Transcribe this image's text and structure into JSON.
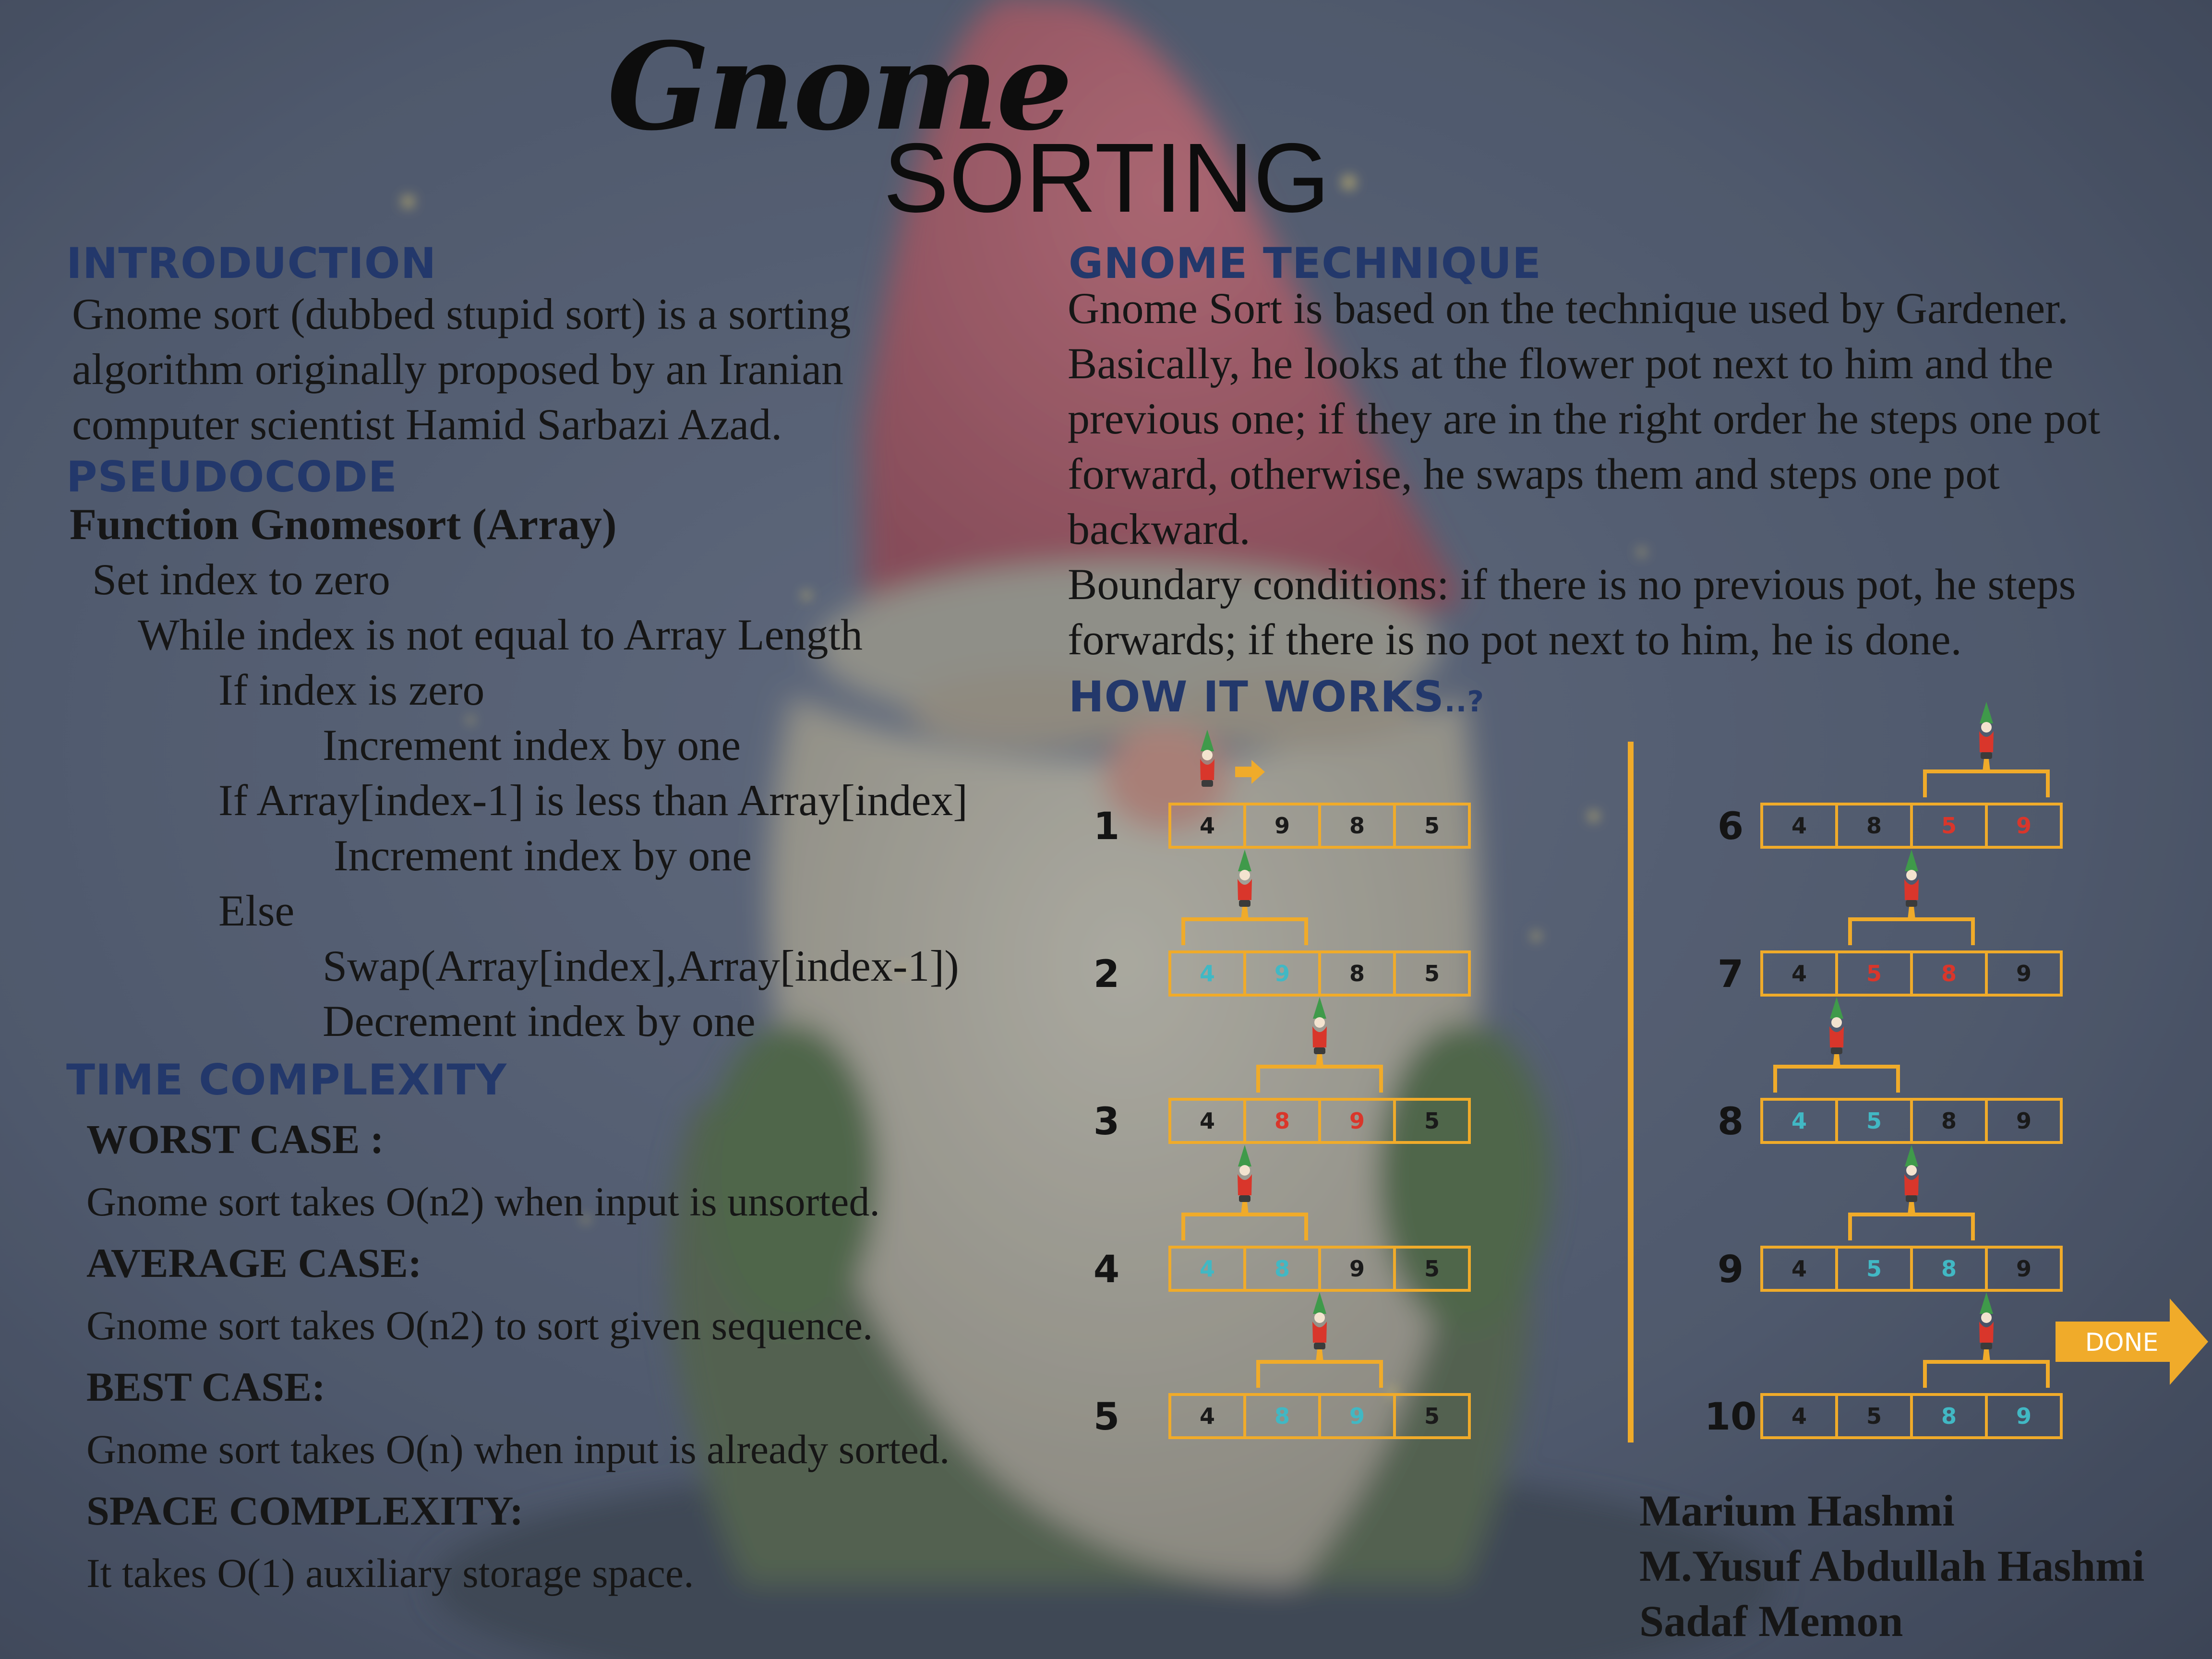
{
  "title": {
    "line1": "Gnome",
    "line2": "SORTING"
  },
  "introduction": {
    "heading": "INTRODUCTION",
    "lines": [
      "Gnome sort (dubbed stupid sort) is a sorting",
      "algorithm originally proposed by an Iranian",
      "computer scientist Hamid Sarbazi Azad."
    ]
  },
  "pseudocode": {
    "heading": "PSEUDOCODE",
    "lines": [
      "Function Gnomesort (Array)",
      "Set index to zero",
      "While index is not equal to Array Length",
      "If  index is zero",
      "Increment index by one",
      "If  Array[index-1] is less than Array[index]",
      "Increment index by one",
      "Else",
      "Swap(Array[index],Array[index-1])",
      "Decrement index by one"
    ]
  },
  "time_complexity": {
    "heading": "TIME COMPLEXITY",
    "worst_label": "WORST CASE :",
    "worst_text": "Gnome sort takes O(n2) when input is unsorted.",
    "average_label": "AVERAGE CASE:",
    "average_text": "Gnome sort takes O(n2) to sort given sequence.",
    "best_label": "BEST CASE:",
    "best_text": "Gnome sort takes O(n) when input is already sorted.",
    "space_label": "SPACE COMPLEXITY:",
    "space_text": "It takes O(1) auxiliary storage space."
  },
  "technique": {
    "heading": "GNOME TECHNIQUE",
    "lines": [
      "Gnome Sort is based on the technique used by Gardener.",
      "Basically, he looks at the flower pot next to him and the",
      "previous one; if they are in the right order he steps one pot",
      "forward, otherwise, he swaps them and steps one pot",
      "backward.",
      "Boundary conditions: if there is no previous pot, he steps",
      "forwards; if there is no pot next to him, he is done."
    ]
  },
  "how_it_works": {
    "heading": "HOW IT WORKS",
    "heading_suffix": "..?",
    "done_label": "DONE",
    "steps": [
      {
        "num": "1",
        "values": [
          "4",
          "9",
          "8",
          "5"
        ],
        "hl": [],
        "hl_color": "",
        "bracket": false
      },
      {
        "num": "2",
        "values": [
          "4",
          "9",
          "8",
          "5"
        ],
        "hl": [
          0,
          1
        ],
        "hl_color": "cyan",
        "bracket": true
      },
      {
        "num": "3",
        "values": [
          "4",
          "8",
          "9",
          "5"
        ],
        "hl": [
          1,
          2
        ],
        "hl_color": "red",
        "bracket": true
      },
      {
        "num": "4",
        "values": [
          "4",
          "8",
          "9",
          "5"
        ],
        "hl": [
          0,
          1
        ],
        "hl_color": "cyan",
        "bracket": true
      },
      {
        "num": "5",
        "values": [
          "4",
          "8",
          "9",
          "5"
        ],
        "hl": [
          1,
          2
        ],
        "hl_color": "cyan",
        "bracket": true
      },
      {
        "num": "6",
        "values": [
          "4",
          "8",
          "5",
          "9"
        ],
        "hl": [
          2,
          3
        ],
        "hl_color": "red",
        "bracket": true
      },
      {
        "num": "7",
        "values": [
          "4",
          "5",
          "8",
          "9"
        ],
        "hl": [
          1,
          2
        ],
        "hl_color": "red",
        "bracket": true
      },
      {
        "num": "8",
        "values": [
          "4",
          "5",
          "8",
          "9"
        ],
        "hl": [
          0,
          1
        ],
        "hl_color": "cyan",
        "bracket": true
      },
      {
        "num": "9",
        "values": [
          "4",
          "5",
          "8",
          "9"
        ],
        "hl": [
          1,
          2
        ],
        "hl_color": "cyan",
        "bracket": true
      },
      {
        "num": "10",
        "values": [
          "4",
          "5",
          "8",
          "9"
        ],
        "hl": [
          2,
          3
        ],
        "hl_color": "cyan",
        "bracket": true
      }
    ]
  },
  "authors": [
    "Marium Hashmi",
    "M.Yusuf Abdullah Hashmi",
    "Sadaf  Memon"
  ],
  "colors": {
    "heading": "#23386b",
    "orange": "#f0ab2a",
    "red": "#d9362b",
    "cyan": "#41b8c4",
    "background": "#4f5a6e"
  }
}
